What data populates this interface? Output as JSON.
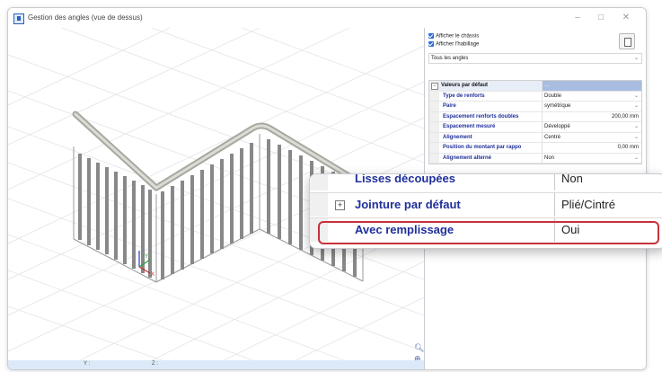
{
  "window": {
    "title": "Gestion des angles (vue de dessus)",
    "minimize": "–",
    "maximize": "□",
    "close": "✕"
  },
  "viewport": {
    "zoom_icons": [
      "magnifier-icon",
      "zoom-window-icon",
      "zoom-in-icon",
      "zoom-out-icon"
    ],
    "axis_labels": {
      "y": "Y",
      "x": "X"
    },
    "status_labels": [
      "Y :",
      "Z :"
    ]
  },
  "panel": {
    "checkboxes": [
      {
        "label": "Afficher le châssis",
        "checked": true
      },
      {
        "label": "Afficher l'habillage",
        "checked": true
      }
    ],
    "corner_select": "Tous les angles",
    "properties": [
      {
        "name": "Valeurs par défaut",
        "value": "…",
        "header": true
      },
      {
        "name": "Type de renforts",
        "value": "Double",
        "dropdown": true
      },
      {
        "name": "Paire",
        "value": "symétrique",
        "dropdown": true
      },
      {
        "name": "Espacement renforts doubles",
        "value": "200,00 mm",
        "dropdown": false
      },
      {
        "name": "Espacement mesuré",
        "value": "Développé",
        "dropdown": true
      },
      {
        "name": "Alignement",
        "value": "Centré",
        "dropdown": true
      },
      {
        "name": "Position du montant par rappo",
        "value": "0,00 mm",
        "dropdown": false
      },
      {
        "name": "Alignement alterné",
        "value": "Non",
        "dropdown": true
      }
    ]
  },
  "zoom_callout": {
    "rows": [
      {
        "name": "Lisses découpées",
        "value": "Non",
        "expand": false
      },
      {
        "name": "Jointure par défaut",
        "value": "Plié/Cintré",
        "expand": true
      },
      {
        "name": "Avec remplissage",
        "value": "Oui",
        "expand": false,
        "highlighted": true
      }
    ],
    "highlight_color": "#c8313a"
  },
  "colors": {
    "accent": "#2f6fd1",
    "property_name": "#1f2f9a"
  }
}
